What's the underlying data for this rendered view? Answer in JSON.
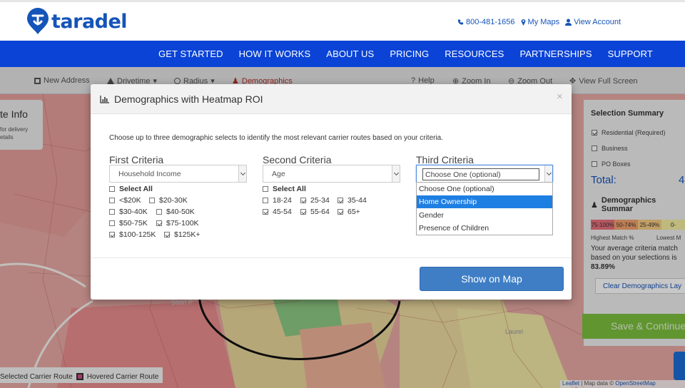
{
  "header": {
    "logo_text": "taradel",
    "phone": "800-481-1656",
    "my_maps": "My Maps",
    "view_account": "View Account"
  },
  "nav": {
    "items": [
      "GET STARTED",
      "HOW IT WORKS",
      "ABOUT US",
      "PRICING",
      "RESOURCES",
      "PARTNERSHIPS",
      "SUPPORT"
    ]
  },
  "toolbar": {
    "new_address": "New Address",
    "drivetime": "Drivetime",
    "radius": "Radius",
    "demographics": "Demographics",
    "help": "Help",
    "zoom_in": "Zoom In",
    "zoom_out": "Zoom Out",
    "full_screen": "View Full Screen"
  },
  "info_card": {
    "title": "te Info",
    "line1": "for delivery",
    "line2": "etails"
  },
  "summary": {
    "title": "Selection Summary",
    "residential": "Residential (Required)",
    "business": "Business",
    "po_boxes": "PO Boxes",
    "total_label": "Total:",
    "total_value": "4",
    "demo_title": "Demographics Summar",
    "legend": [
      "75-100%",
      "50-74%",
      "25-49%",
      "0-"
    ],
    "legend_colors": [
      "#e8707c",
      "#f3a26e",
      "#f6cc83",
      "#f4eea0"
    ],
    "highest": "Highest Match %",
    "lowest": "Lowest M",
    "avg_line1": "Your average criteria match",
    "avg_line2": "based on your selections is",
    "avg_value": "83.89%",
    "clear_btn": "Clear Demographics Lay",
    "save_btn": "Save & Continue"
  },
  "bottom_legend": {
    "selected": "Selected Carrier Route",
    "hovered": "Hovered Carrier Route"
  },
  "attribution": {
    "leaflet": "Leaflet",
    "map_data": " | Map data © ",
    "osm": "OpenStreetMap",
    "contrib": " contributor"
  },
  "map_labels": {
    "short_pump": "Short P",
    "laurel": "Laurel"
  },
  "modal": {
    "title": "Demographics with Heatmap ROI",
    "close": "×",
    "description": "Choose up to three demographic selects to identify the most relevant carrier routes based on your criteria.",
    "first": {
      "title": "First Criteria",
      "value": "Household Income",
      "select_all": "Select All",
      "options": [
        {
          "label": "<$20K",
          "checked": false
        },
        {
          "label": "$20-30K",
          "checked": false
        },
        {
          "label": "$30-40K",
          "checked": false
        },
        {
          "label": "$40-50K",
          "checked": false
        },
        {
          "label": "$50-75K",
          "checked": false
        },
        {
          "label": "$75-100K",
          "checked": true
        },
        {
          "label": "$100-125K",
          "checked": true
        },
        {
          "label": "$125K+",
          "checked": true
        }
      ]
    },
    "second": {
      "title": "Second Criteria",
      "value": "Age",
      "select_all": "Select All",
      "options": [
        {
          "label": "18-24",
          "checked": false
        },
        {
          "label": "25-34",
          "checked": true
        },
        {
          "label": "35-44",
          "checked": true
        },
        {
          "label": "45-54",
          "checked": true
        },
        {
          "label": "55-64",
          "checked": true
        },
        {
          "label": "65+",
          "checked": true
        }
      ]
    },
    "third": {
      "title": "Third Criteria",
      "value": "Choose One (optional)",
      "dropdown": [
        "Choose One (optional)",
        "Home Ownership",
        "Gender",
        "Presence of Children"
      ],
      "highlighted": "Home Ownership"
    },
    "show_btn": "Show on Map"
  }
}
